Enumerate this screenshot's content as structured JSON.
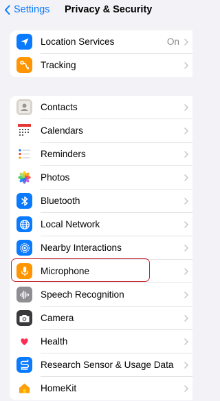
{
  "navbar": {
    "back_label": "Settings",
    "title": "Privacy & Security"
  },
  "section1": [
    {
      "name": "location",
      "label": "Location Services",
      "value": "On",
      "icon": "location-arrow-icon",
      "color": "#0a7aff"
    },
    {
      "name": "tracking",
      "label": "Tracking",
      "icon": "tracking-icon",
      "color": "#ff9500"
    }
  ],
  "section2": [
    {
      "name": "contacts",
      "label": "Contacts",
      "icon": "contacts-icon",
      "color": "#d8d3cb"
    },
    {
      "name": "calendars",
      "label": "Calendars",
      "icon": "calendar-icon",
      "color": "#ffffff"
    },
    {
      "name": "reminders",
      "label": "Reminders",
      "icon": "reminders-icon",
      "color": "#ffffff"
    },
    {
      "name": "photos",
      "label": "Photos",
      "icon": "photos-icon",
      "color": "#ffffff"
    },
    {
      "name": "bluetooth",
      "label": "Bluetooth",
      "icon": "bluetooth-icon",
      "color": "#0a7aff"
    },
    {
      "name": "local-network",
      "label": "Local Network",
      "icon": "globe-icon",
      "color": "#0a7aff"
    },
    {
      "name": "nearby-interactions",
      "label": "Nearby Interactions",
      "icon": "nearby-icon",
      "color": "#0a7aff"
    },
    {
      "name": "microphone",
      "label": "Microphone",
      "icon": "microphone-icon",
      "color": "#ff9500"
    },
    {
      "name": "speech-recognition",
      "label": "Speech Recognition",
      "icon": "waveform-icon",
      "color": "#8e8e93"
    },
    {
      "name": "camera",
      "label": "Camera",
      "icon": "camera-icon",
      "color": "#3a3a3c"
    },
    {
      "name": "health",
      "label": "Health",
      "icon": "heart-icon",
      "color": "#ffffff"
    },
    {
      "name": "research",
      "label": "Research Sensor & Usage Data",
      "icon": "research-icon",
      "color": "#0a7aff"
    },
    {
      "name": "homekit",
      "label": "HomeKit",
      "icon": "home-icon",
      "color": "#ffffff"
    }
  ],
  "highlighted_item": "Microphone"
}
